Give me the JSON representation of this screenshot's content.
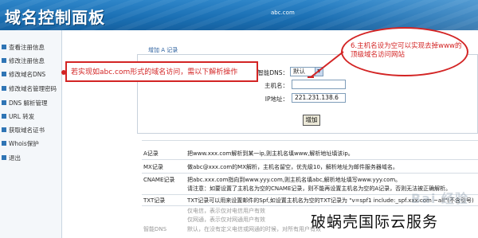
{
  "header": {
    "logo": "域名控制面板",
    "logo_sub": "",
    "domain": "abc.com"
  },
  "sidebar": {
    "items": [
      {
        "label": "查看注册信息"
      },
      {
        "label": "修改注册信息"
      },
      {
        "label": "修改域名DNS"
      },
      {
        "label": "修改域名管理密码"
      },
      {
        "label": "DNS 解析管理"
      },
      {
        "label": "URL 转发"
      },
      {
        "label": "获取域名证书"
      },
      {
        "label": "Whois保护"
      },
      {
        "label": "退出"
      }
    ]
  },
  "form": {
    "section_title": "增加 A 记录",
    "dns_label": "智能DNS：",
    "dns_value": "默认",
    "host_label": "主机名：",
    "host_value": "",
    "ip_label": "IP地址：",
    "ip_value": "221.231.138.6",
    "submit_label": "增加"
  },
  "annotations": {
    "left_note": "若实现如abc.com形式的域名访问，需以下解析操作",
    "right_note": "6.主机名设为空可以实现去掉www的顶级域名访问网站"
  },
  "records": [
    {
      "key": "A记录",
      "desc": "把www.xxx.com解析到某一ip,则主机名填www,解析地址填该ip。"
    },
    {
      "key": "MX记录",
      "desc": "做abc@xxx.com的MX解析，主机名留空，优先级10，解析地址为邮件服务器域名。"
    },
    {
      "key": "CNAME记录",
      "desc": "把abc.xxx.com指向到www.yyy.com,则主机名填abc,解析地址填写www.yyy.com。"
    },
    {
      "key": "",
      "desc": "请注意：如要设置了主机名为空的CNAME记录，则不能再设置主机名为空的A记录，否则无法被正确解析。"
    },
    {
      "key": "TXT记录",
      "desc": "TXT记录可以用来设置邮件的Spf,如设置主机名为空的TXT记录为 \"v=spf1 include:_spf.xxx.com ~all\"(不含引号)"
    },
    {
      "key": "",
      "desc": "仅电信，表示仅对电信用户有效",
      "faded": true
    },
    {
      "key": "",
      "desc": "仅网通，表示仅对网通用户有效",
      "faded": true
    },
    {
      "key": "智能DNS",
      "desc": "默认，在没有定义电信或网通的时候，对所有用户有效",
      "faded": true
    }
  ],
  "watermarks": {
    "baidu": "Bai 经验",
    "caption": "破蜗壳国际云服务"
  },
  "colors": {
    "header_blue": "#1a6fb3",
    "annotation_red": "#d32424",
    "sidebar_bullet": "#2f75b5"
  }
}
